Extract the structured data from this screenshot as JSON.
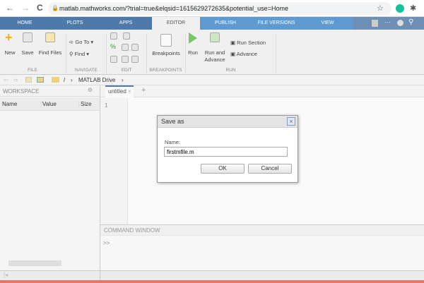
{
  "browser": {
    "url": "matlab.mathworks.com/?trial=true&elqsid=1615629272635&potential_use=Home",
    "back": "←",
    "forward": "→",
    "reload": "C",
    "star": "☆"
  },
  "ribbon_tabs": [
    "HOME",
    "PLOTS",
    "APPS",
    "EDITOR",
    "PUBLISH",
    "FILE VERSIONS",
    "VIEW"
  ],
  "ribbon": {
    "file": {
      "new": "New",
      "save": "Save",
      "find_files": "Find Files",
      "group": "FILE"
    },
    "navigate": {
      "goto": "Go To",
      "find": "Find",
      "group": "NAVIGATE"
    },
    "edit": {
      "group": "EDIT"
    },
    "breakpoints": {
      "label": "Breakpoints",
      "group": "BREAKPOINTS"
    },
    "run": {
      "run": "Run",
      "run_advance": "Run and Advance",
      "run_section": "Run Section",
      "advance": "Advance",
      "group": "RUN"
    }
  },
  "path": {
    "sep": "/",
    "drive": "MATLAB Drive",
    "chevron": "›"
  },
  "workspace": {
    "title": "WORKSPACE",
    "columns": [
      "Name",
      "Value",
      "Size"
    ]
  },
  "editor": {
    "tab": "untitled",
    "close": "×",
    "add": "+",
    "line_numbers": [
      "1"
    ]
  },
  "command_window": {
    "title": "COMMAND WINDOW",
    "prompt": ">>"
  },
  "dialog": {
    "title": "Save as",
    "close": "×",
    "name_label": "Name:",
    "name_value": "firstmfile.m",
    "ok": "OK",
    "cancel": "Cancel"
  },
  "colors": {
    "tab_bar": "#4d7aa8",
    "status_strip": "#e8776a"
  }
}
